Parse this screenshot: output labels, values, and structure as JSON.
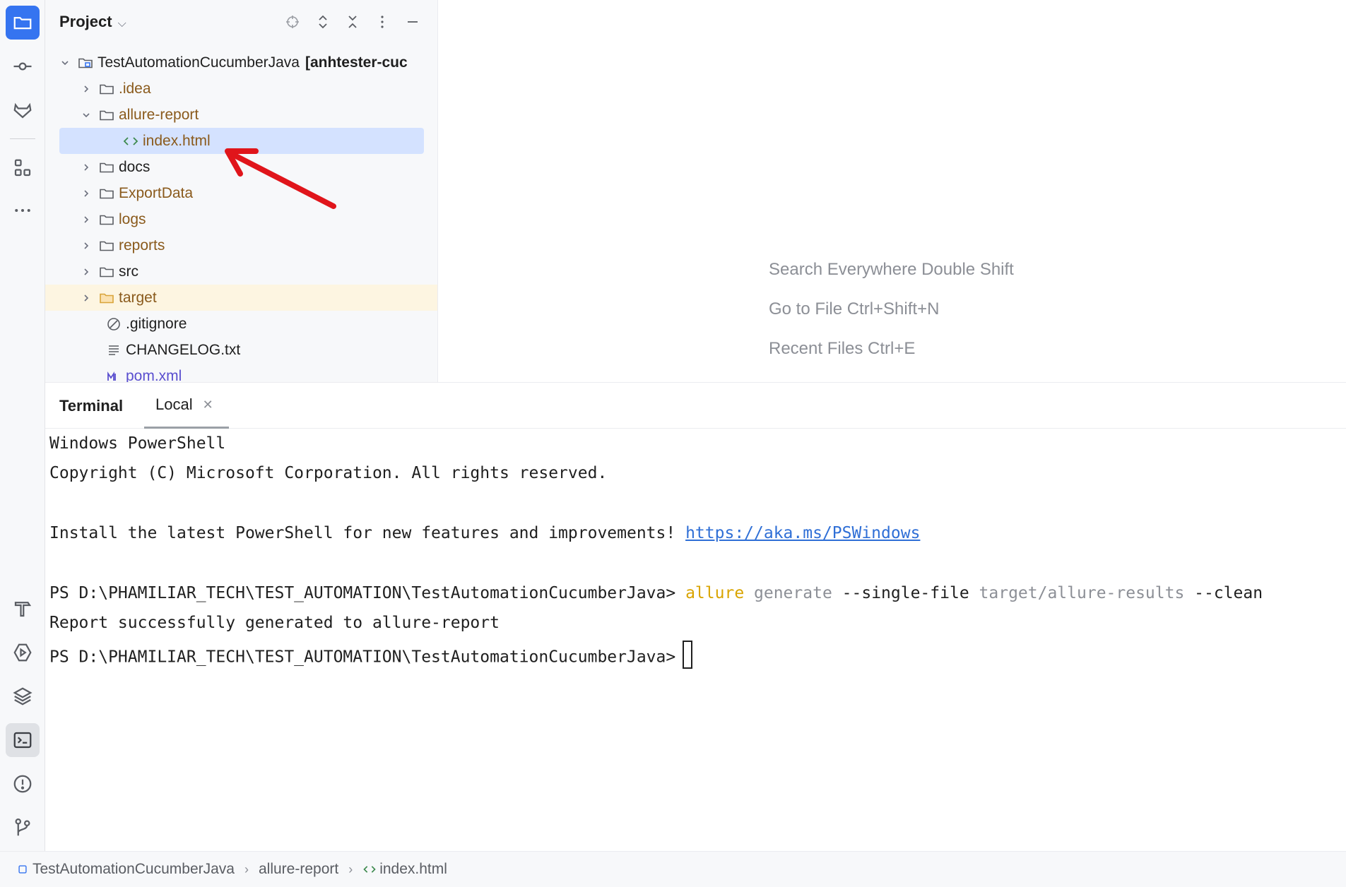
{
  "project_panel": {
    "title": "Project",
    "tree": [
      {
        "label": "TestAutomationCucumberJava",
        "suffix": "[anhtester-cuc",
        "type": "module",
        "expanded": true
      },
      {
        "label": ".idea",
        "type": "folder",
        "expanded": false
      },
      {
        "label": "allure-report",
        "type": "folder",
        "expanded": true
      },
      {
        "label": "index.html",
        "type": "html-file",
        "selected": true
      },
      {
        "label": "docs",
        "type": "folder",
        "expanded": false
      },
      {
        "label": "ExportData",
        "type": "folder",
        "expanded": false
      },
      {
        "label": "logs",
        "type": "folder",
        "expanded": false
      },
      {
        "label": "reports",
        "type": "folder",
        "expanded": false
      },
      {
        "label": "src",
        "type": "folder",
        "expanded": false
      },
      {
        "label": "target",
        "type": "folder",
        "expanded": false,
        "excluded": true
      },
      {
        "label": ".gitignore",
        "type": "ignore-file"
      },
      {
        "label": "CHANGELOG.txt",
        "type": "text-file"
      },
      {
        "label": "pom.xml",
        "type": "maven-file"
      }
    ]
  },
  "editor": {
    "hints": [
      "Search Everywhere Double Shift",
      "Go to File Ctrl+Shift+N",
      "Recent Files Ctrl+E"
    ]
  },
  "terminal": {
    "title": "Terminal",
    "tab_label": "Local",
    "lines": {
      "l1": "Windows PowerShell",
      "l2": "Copyright (C) Microsoft Corporation. All rights reserved.",
      "l3_text": "Install the latest PowerShell for new features and improvements! ",
      "l3_link": "https://aka.ms/PSWindows",
      "prompt": "PS D:\\PHAMILIAR_TECH\\TEST_AUTOMATION\\TestAutomationCucumberJava> ",
      "cmd_allure": "allure",
      "cmd_generate": " generate ",
      "cmd_flag1": "--single-file ",
      "cmd_path": "target/allure-results ",
      "cmd_flag2": "--clean",
      "l5": "Report successfully generated to allure-report",
      "prompt2": "PS D:\\PHAMILIAR_TECH\\TEST_AUTOMATION\\TestAutomationCucumberJava>"
    }
  },
  "statusbar": {
    "crumbs": [
      "TestAutomationCucumberJava",
      "allure-report",
      "index.html"
    ]
  },
  "colors": {
    "accent": "#3574f0",
    "selection": "#d4e2ff",
    "excluded": "#fdf5e1",
    "annotation_arrow": "#e0151b"
  }
}
